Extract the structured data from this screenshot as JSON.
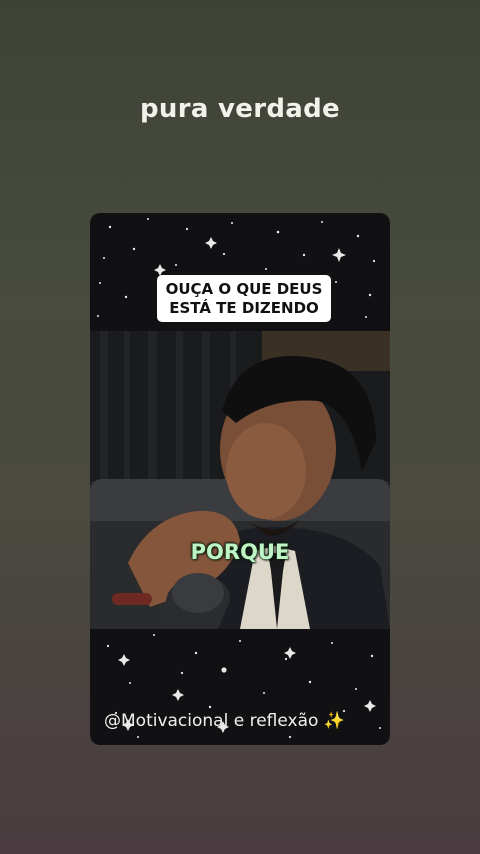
{
  "story": {
    "caption": "pura verdade"
  },
  "video": {
    "headline_line1": "OUÇA O QUE DEUS",
    "headline_line2": "ESTÁ TE DIZENDO",
    "subtitle": "PORQUE",
    "watermark": "@Motivacional e reflexão",
    "watermark_emoji": "✨"
  },
  "colors": {
    "subtitle": "#bff5c6",
    "watermark_emoji": "#f6c945"
  }
}
